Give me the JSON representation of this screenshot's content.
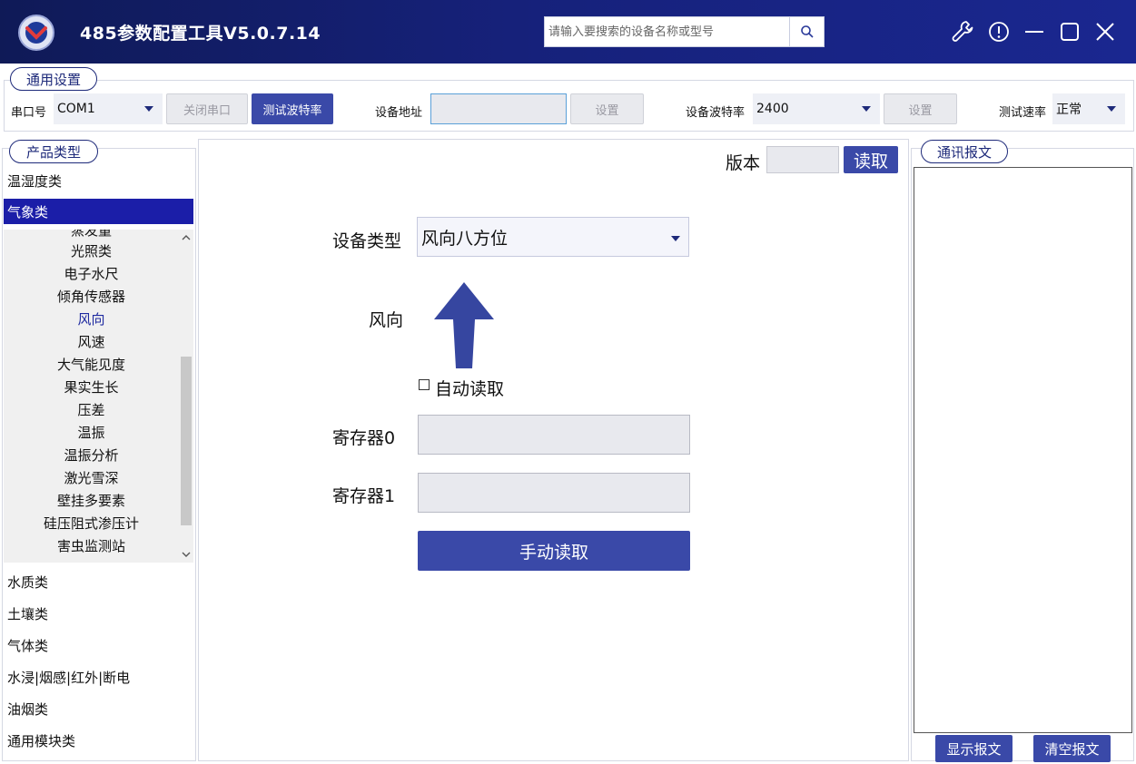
{
  "app": {
    "title": "485参数配置工具V5.0.7.14",
    "search_placeholder": "请输入要搜索的设备名称或型号"
  },
  "titlebar_icons": [
    "wrench-icon",
    "info-icon",
    "minimize-icon",
    "maximize-icon",
    "close-icon"
  ],
  "general": {
    "group_label": "通用设置",
    "port_label": "串口号",
    "port_value": "COM1",
    "close_port": "关闭串口",
    "test_baud": "测试波特率",
    "addr_label": "设备地址",
    "addr_value": "",
    "set_addr": "设置",
    "baud_label": "设备波特率",
    "baud_value": "2400",
    "set_baud": "设置",
    "speed_label": "测试速率",
    "speed_value": "正常"
  },
  "sidebar": {
    "group_label": "产品类型",
    "top_categories": [
      "温湿度类",
      "气象类"
    ],
    "active_category": "气象类",
    "sub_partial": "蒸发量",
    "sub_items": [
      "光照类",
      "电子水尺",
      "倾角传感器",
      "风向",
      "风速",
      "大气能见度",
      "果实生长",
      "压差",
      "温振",
      "温振分析",
      "激光雪深",
      "壁挂多要素",
      "硅压阻式渗压计",
      "害虫监测站"
    ],
    "active_sub": "风向",
    "bottom_categories": [
      "水质类",
      "土壤类",
      "气体类",
      "水浸|烟感|红外|断电",
      "油烟类",
      "通用模块类"
    ]
  },
  "main": {
    "version_label": "版本",
    "version_value": "",
    "read_btn": "读取",
    "device_type_label": "设备类型",
    "device_type_value": "风向八方位",
    "direction_label": "风向",
    "auto_read": "自动读取",
    "auto_read_checked": false,
    "reg0_label": "寄存器0",
    "reg0_value": "",
    "reg1_label": "寄存器1",
    "reg1_value": "",
    "manual_read": "手动读取"
  },
  "comm": {
    "group_label": "通讯报文",
    "log": "",
    "show_btn": "显示报文",
    "clear_btn": "清空报文"
  },
  "colors": {
    "titlebar": "#16217a",
    "accent": "#3a49a8",
    "active_category": "#1b1ea8",
    "arrow": "#3646a0"
  }
}
